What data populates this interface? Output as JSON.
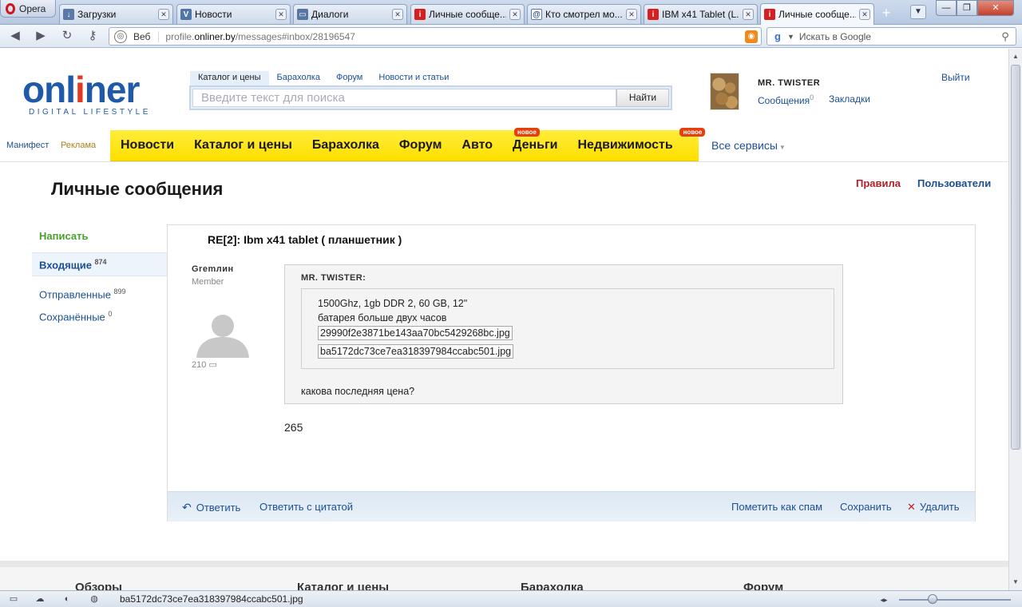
{
  "browser": {
    "menu_label": "Opera",
    "tabs": [
      {
        "label": "Загрузки",
        "icon": "download-icon"
      },
      {
        "label": "Новости",
        "icon": "vk-icon"
      },
      {
        "label": "Диалоги",
        "icon": "dialogs-icon"
      },
      {
        "label": "Личные сообще...",
        "icon": "onliner-icon"
      },
      {
        "label": "Кто смотрел мо...",
        "icon": "at-icon"
      },
      {
        "label": "IBM x41 Tablet (L...",
        "icon": "onliner-icon"
      },
      {
        "label": "Личные сообще...",
        "icon": "onliner-icon",
        "active": true
      }
    ],
    "address": {
      "label": "Веб",
      "url_prefix": "profile.",
      "url_host": "onliner.by",
      "url_path": "/messages#inbox/28196547"
    },
    "search_placeholder": "Искать в Google",
    "status_text": "ba5172dc73ce7ea318397984ccabc501.jpg"
  },
  "site": {
    "logo_text_pre": "onl",
    "logo_text_i": "i",
    "logo_text_post": "ner",
    "logo_tagline": "DIGITAL LIFESTYLE",
    "top_tabs": [
      "Каталог и цены",
      "Барахолка",
      "Форум",
      "Новости и статьи"
    ],
    "search_placeholder": "Введите текст для поиска",
    "search_button": "Найти",
    "user": {
      "name": "MR. TWISTER",
      "messages_label": "Сообщения",
      "messages_count": "0",
      "bookmarks_label": "Закладки",
      "logout_label": "Выйти"
    },
    "left_links": {
      "manifest": "Манифест",
      "ads": "Реклама"
    },
    "menu": [
      {
        "label": "Новости"
      },
      {
        "label": "Каталог и цены"
      },
      {
        "label": "Барахолка"
      },
      {
        "label": "Форум"
      },
      {
        "label": "Авто"
      },
      {
        "label": "Деньги",
        "badge": "новое"
      },
      {
        "label": "Недвижимость",
        "badge": "новое"
      }
    ],
    "all_services": "Все сервисы"
  },
  "page": {
    "title": "Личные сообщения",
    "rules_link": "Правила",
    "users_link": "Пользователи",
    "sidebar": {
      "write": "Написать",
      "inbox": "Входящие",
      "inbox_count": "874",
      "sent": "Отправленные",
      "sent_count": "899",
      "saved": "Сохранённые",
      "saved_count": "0"
    },
    "message": {
      "subject": "RE[2]: Ibm x41 tablet ( планшетник )",
      "author": "Gremлин",
      "role": "Member",
      "post_count": "210",
      "quote_author": "MR. TWISTER:",
      "quote_line1": "1500Ghz, 1gb DDR 2, 60 GB, 12\"",
      "quote_line2": "батарея больше двух часов",
      "file1": "29990f2e3871be143aa70bc5429268bc.jpg",
      "file2": "ba5172dc73ce7ea318397984ccabc501.jpg",
      "quote_after": "какова последняя цена?",
      "reply": "265"
    },
    "actions": {
      "reply": "Ответить",
      "reply_quote": "Ответить с цитатой",
      "mark_spam": "Пометить как спам",
      "save": "Сохранить",
      "delete": "Удалить"
    },
    "footer": [
      "Обзоры",
      "Каталог и цены",
      "Барахолка",
      "Форум"
    ]
  }
}
